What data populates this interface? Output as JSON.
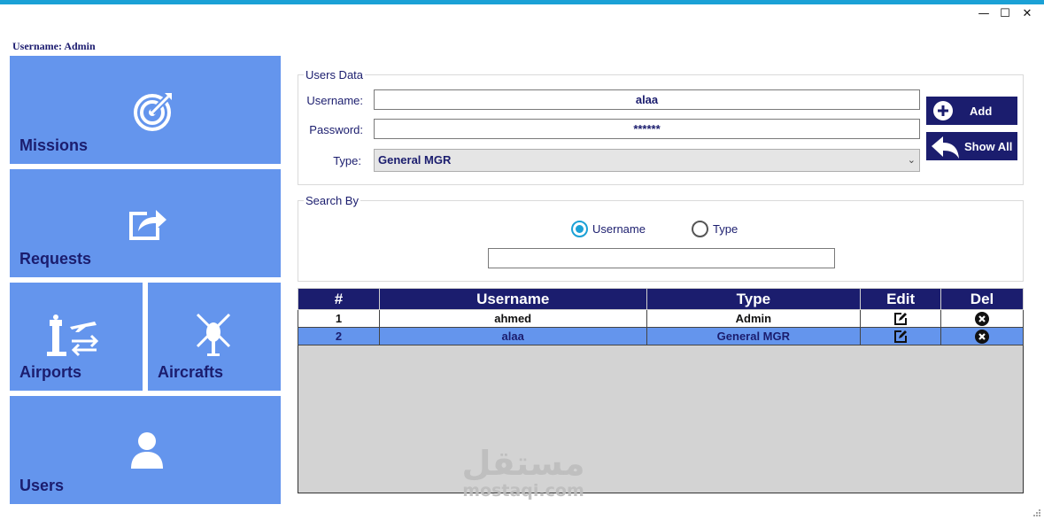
{
  "window": {
    "controls": {
      "minimize": "—",
      "maximize": "☐",
      "close": "✕"
    }
  },
  "session": {
    "user_label": "Username: Admin"
  },
  "nav": {
    "tiles": [
      {
        "label": "Missions",
        "icon": "target-icon"
      },
      {
        "label": "Requests",
        "icon": "share-icon"
      },
      {
        "label": "Airports",
        "icon": "airport-icon"
      },
      {
        "label": "Aircrafts",
        "icon": "helicopter-icon"
      },
      {
        "label": "Users",
        "icon": "user-icon"
      }
    ]
  },
  "users_data": {
    "title": "Users Data",
    "username_label": "Username:",
    "username_value": "alaa",
    "password_label": "Password:",
    "password_value": "******",
    "type_label": "Type:",
    "type_value": "General MGR",
    "add_button": "Add",
    "show_all_button": "Show All"
  },
  "search": {
    "title": "Search By",
    "option_username": "Username",
    "option_type": "Type",
    "selected": "Username",
    "query": ""
  },
  "table": {
    "columns": [
      "#",
      "Username",
      "Type",
      "Edit",
      "Del"
    ],
    "rows": [
      {
        "num": "1",
        "username": "ahmed",
        "type": "Admin",
        "selected": false
      },
      {
        "num": "2",
        "username": "alaa",
        "type": "General MGR",
        "selected": true
      }
    ]
  },
  "watermark": {
    "arabic": "مستقل",
    "latin": "mostaqi.com"
  },
  "colors": {
    "accent": "#1ba1d6",
    "tile": "#6495ed",
    "navy": "#1b1d6e",
    "grid_bg": "#d3d3d3"
  }
}
